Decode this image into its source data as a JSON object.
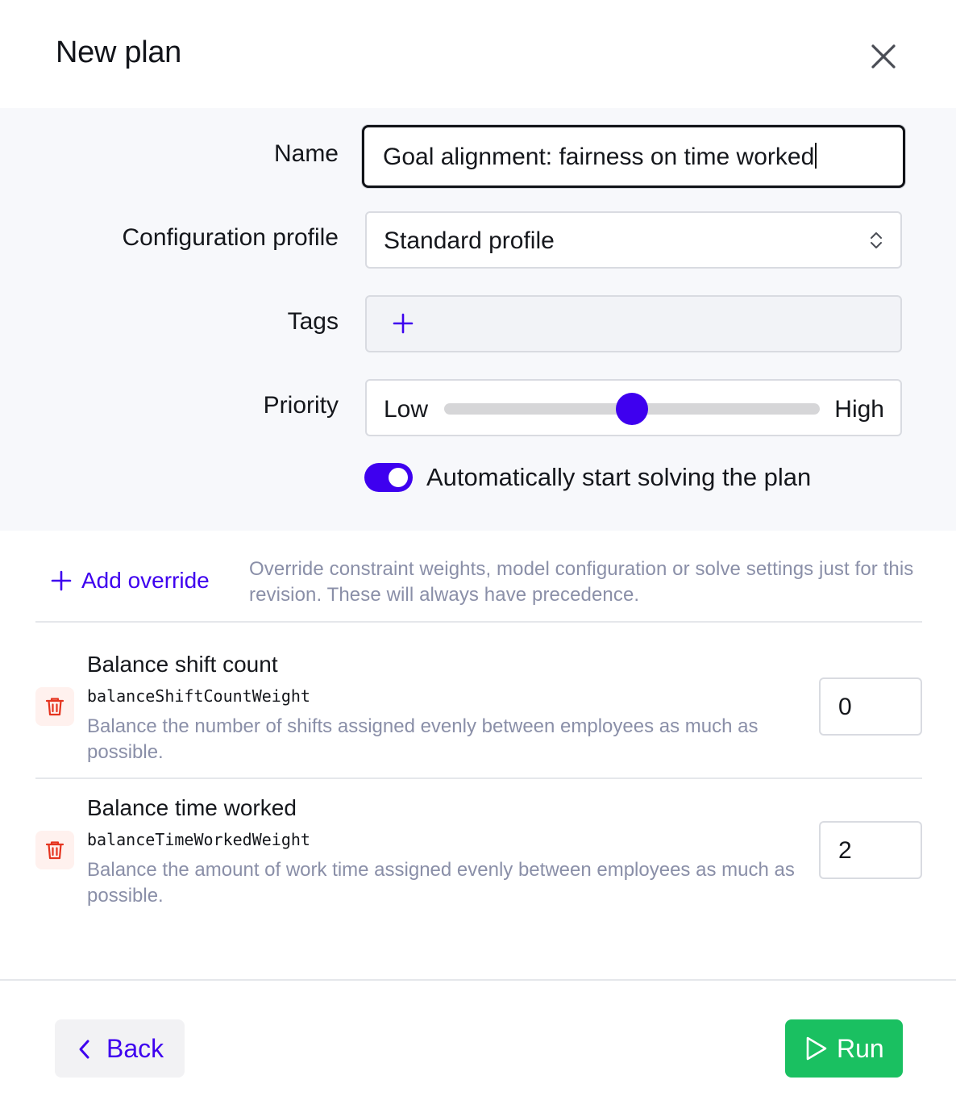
{
  "dialog": {
    "title": "New plan",
    "close_icon": "close-icon"
  },
  "form": {
    "name_label": "Name",
    "name_value": "Goal alignment: fairness on time worked",
    "profile_label": "Configuration profile",
    "profile_value": "Standard profile",
    "tags_label": "Tags",
    "tags_add_icon": "plus-icon",
    "priority_label": "Priority",
    "priority_low": "Low",
    "priority_high": "High",
    "priority_level": 0.5,
    "auto_start_label": "Automatically start solving the plan",
    "auto_start_enabled": true
  },
  "overrides": {
    "add_label": "Add override",
    "help_text": "Override constraint weights, model configuration or solve settings just for this revision. These will always have precedence.",
    "items": [
      {
        "title": "Balance shift count",
        "key": "balanceShiftCountWeight",
        "description": "Balance the number of shifts assigned evenly between employees as much as possible.",
        "value": "0"
      },
      {
        "title": "Balance time worked",
        "key": "balanceTimeWorkedWeight",
        "description": "Balance the amount of work time assigned evenly between employees as much as possible.",
        "value": "2"
      }
    ]
  },
  "footer": {
    "back_label": "Back",
    "run_label": "Run"
  },
  "colors": {
    "accent": "#3e00ef",
    "run": "#1ac061",
    "danger": "#e5341f",
    "muted_text": "#8a8fa8"
  }
}
